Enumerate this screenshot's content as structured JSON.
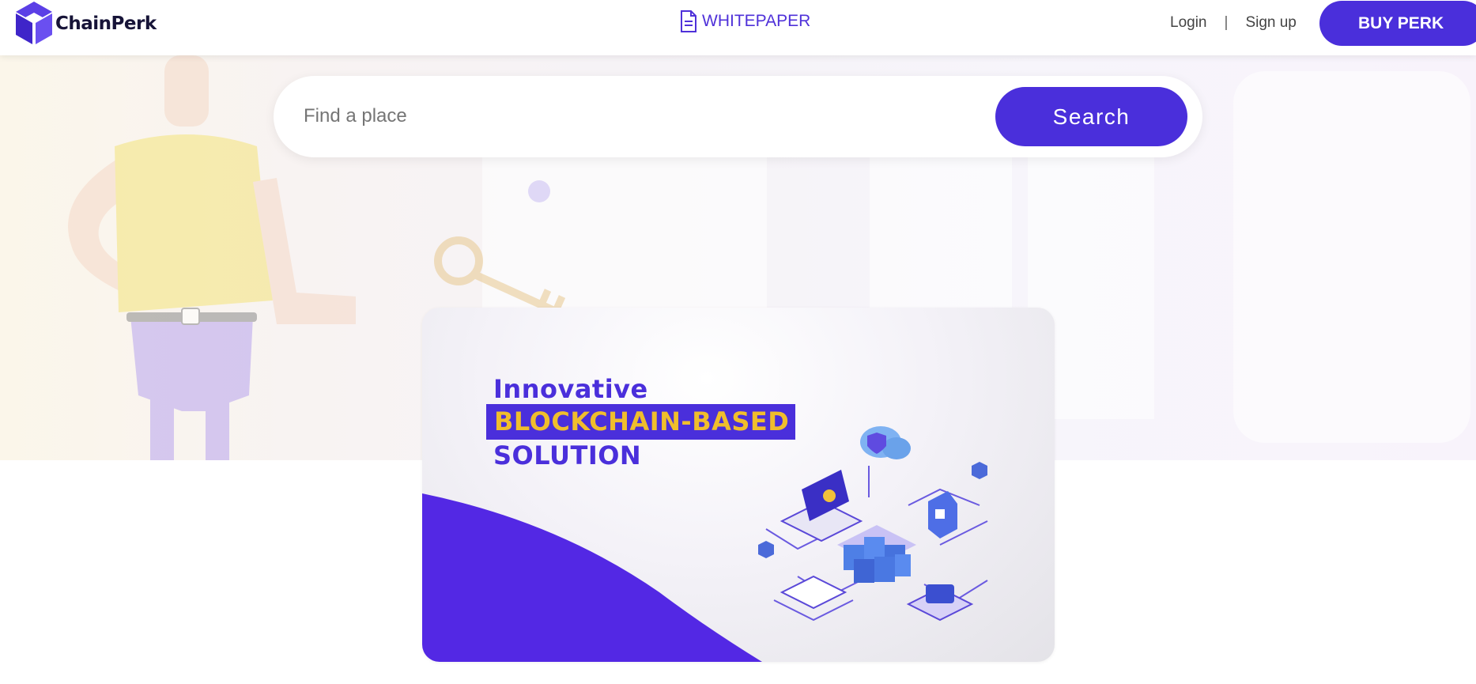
{
  "header": {
    "logo_text": "ChainPerk",
    "whitepaper_label": "WHITEPAPER",
    "login_label": "Login",
    "separator": "|",
    "signup_label": "Sign up",
    "buy_label": "BUY PERK"
  },
  "search": {
    "placeholder": "Find a place",
    "button_label": "Search"
  },
  "banner": {
    "line1": "Innovative",
    "line2": "BLOCKCHAIN-BASED",
    "line3": "SOLUTION"
  },
  "colors": {
    "accent": "#4a2fdb",
    "highlight_text": "#f0be2c",
    "logo_dark": "#171438"
  },
  "icons": {
    "logo": "hexagon-cube-logo-icon",
    "whitepaper": "document-icon"
  }
}
